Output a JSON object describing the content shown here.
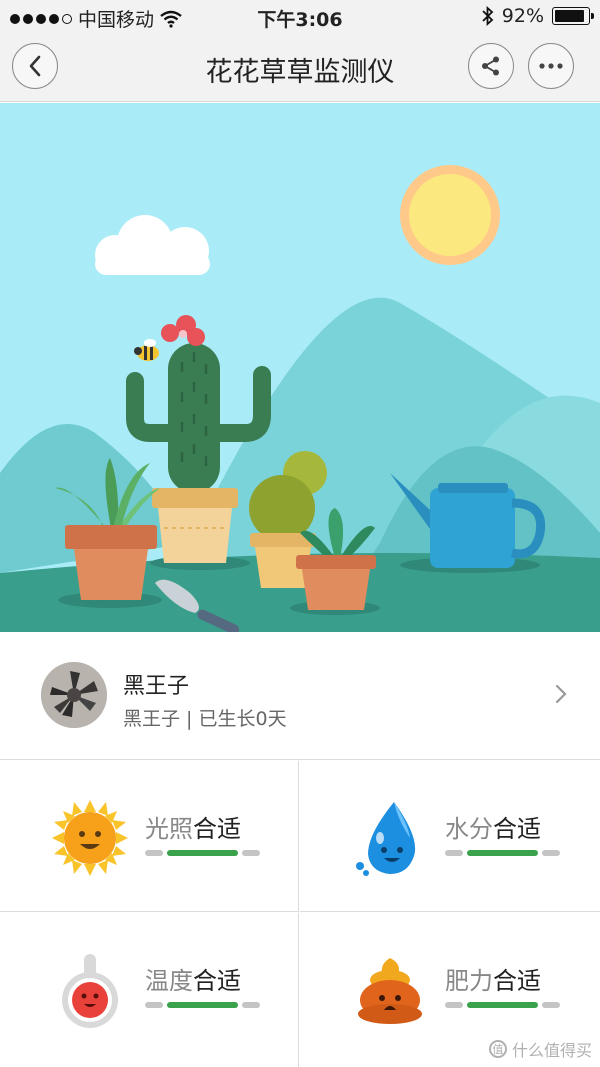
{
  "status_bar": {
    "carrier": "中国移动",
    "time": "下午3:06",
    "battery_text": "92%",
    "battery_level": 0.92,
    "signal_icon": "signal-dots-icon",
    "wifi_icon": "wifi-icon",
    "bluetooth_icon": "bluetooth-icon"
  },
  "nav": {
    "title": "花花草草监测仪",
    "back_icon": "chevron-left-icon",
    "share_icon": "share-icon",
    "more_icon": "more-dots-icon"
  },
  "hero": {
    "scene_icon": "garden-illustration",
    "sky_color": "#a9ecf7",
    "ground_color": "#3a9e8c"
  },
  "plant": {
    "name": "黑王子",
    "subtitle": "黑王子 | 已生长0天",
    "chevron_icon": "chevron-right-icon"
  },
  "metrics": [
    {
      "label": "光照",
      "status": "合适",
      "icon": "sun-icon",
      "level": "ok"
    },
    {
      "label": "水分",
      "status": "合适",
      "icon": "water-drop-icon",
      "level": "ok"
    },
    {
      "label": "温度",
      "status": "合适",
      "icon": "thermometer-icon",
      "level": "ok"
    },
    {
      "label": "肥力",
      "status": "合适",
      "icon": "fertilizer-icon",
      "level": "ok"
    }
  ],
  "colors": {
    "accent_green": "#3aa24a",
    "bar_gray": "#c4c4c4"
  },
  "watermark": "什么值得买"
}
